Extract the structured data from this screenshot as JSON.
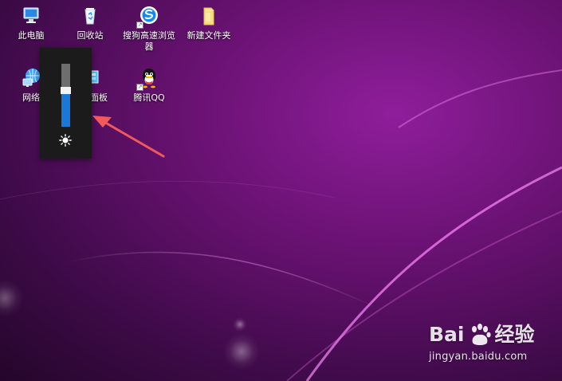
{
  "desktop": {
    "icons": [
      {
        "label": "此电脑",
        "icon": "computer-icon"
      },
      {
        "label": "回收站",
        "icon": "recycle-bin-icon"
      },
      {
        "label": "搜狗高速浏览器",
        "icon": "browser-icon"
      },
      {
        "label": "新建文件夹",
        "icon": "folder-icon"
      },
      {
        "label": "网络",
        "icon": "network-icon"
      },
      {
        "label": "控制面板",
        "icon": "control-panel-icon"
      },
      {
        "label": "腾讯QQ",
        "icon": "qq-icon"
      }
    ]
  },
  "brightness": {
    "value": 0.52,
    "icon": "sun-icon",
    "colors": {
      "panel": "#1b1b1b",
      "track": "#6e6e6e",
      "fill": "#1a79d8",
      "thumb": "#f4f4f4"
    }
  },
  "annotation": {
    "arrow_color": "#f05a5a"
  },
  "watermark": {
    "brand": "Bai",
    "product": "经验",
    "url": "jingyan.baidu.com"
  }
}
